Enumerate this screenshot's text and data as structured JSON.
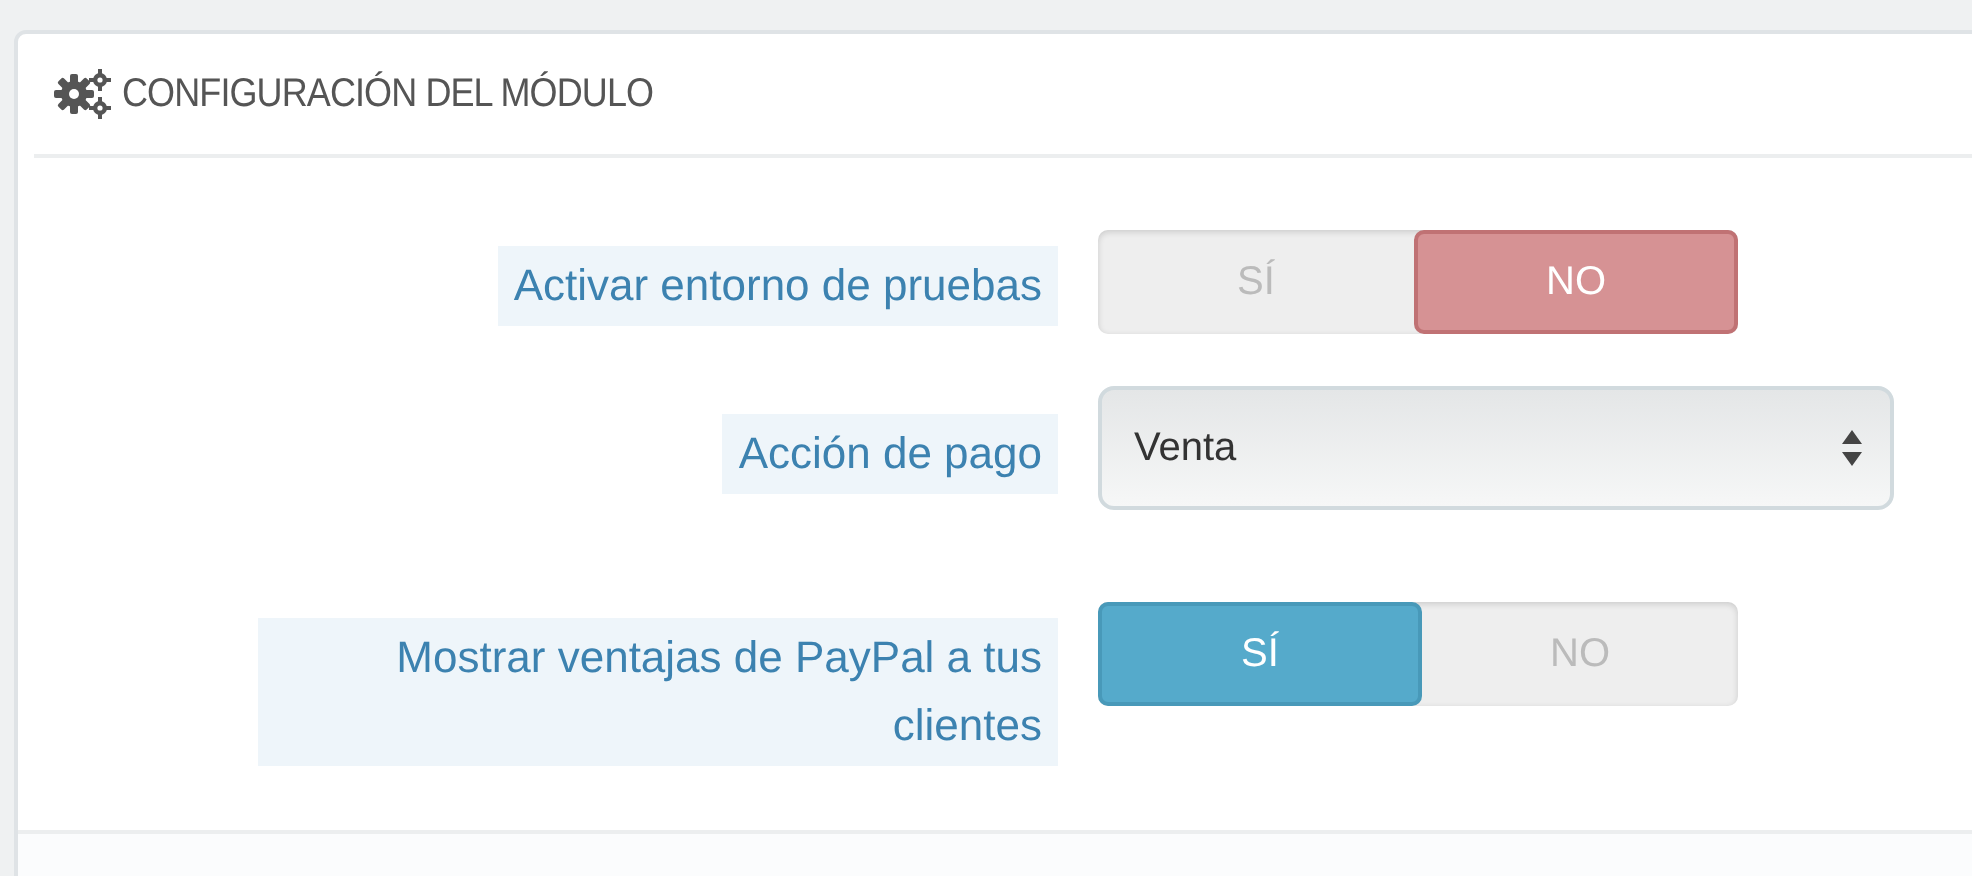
{
  "panel": {
    "title": "CONFIGURACIÓN DEL MÓDULO"
  },
  "fields": [
    {
      "kind": "switch",
      "label": "Activar entorno de pruebas",
      "options": [
        {
          "label": "SÍ",
          "selected": false
        },
        {
          "label": "NO",
          "selected": true
        }
      ]
    },
    {
      "kind": "select",
      "label": "Acción de pago",
      "value": "Venta"
    },
    {
      "kind": "switch",
      "label": "Mostrar ventajas de PayPal a tus clientes",
      "options": [
        {
          "label": "SÍ",
          "selected": true
        },
        {
          "label": "NO",
          "selected": false
        }
      ]
    }
  ]
}
